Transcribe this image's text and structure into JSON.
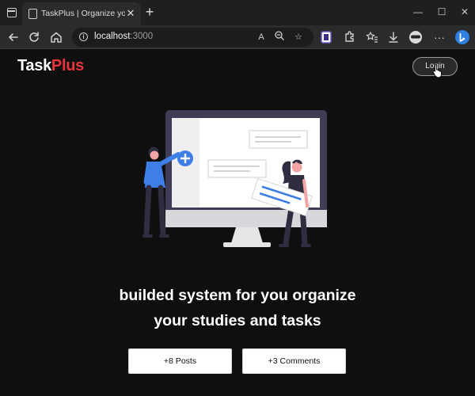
{
  "browser": {
    "tab_title": "TaskPlus | Organize your tasks ea",
    "tab_close": "✕",
    "new_tab": "+",
    "url_host": "localhost",
    "url_port": ":3000",
    "read_aloud_label": "A",
    "window_controls": [
      "minimize-icon",
      "maximize-icon",
      "close-icon"
    ]
  },
  "header": {
    "logo_main": "Task",
    "logo_accent": "Plus",
    "login_label": "Login"
  },
  "hero": {
    "headline_line1": "builded system for you organize",
    "headline_line2": "your studies and tasks"
  },
  "stats": {
    "posts_label": "+8 Posts",
    "comments_label": "+3 Comments"
  },
  "colors": {
    "background": "#0f0f0f",
    "accent": "#e8343a",
    "illustration_blue": "#3d7fe6",
    "monitor_frame": "#3f3d56"
  }
}
